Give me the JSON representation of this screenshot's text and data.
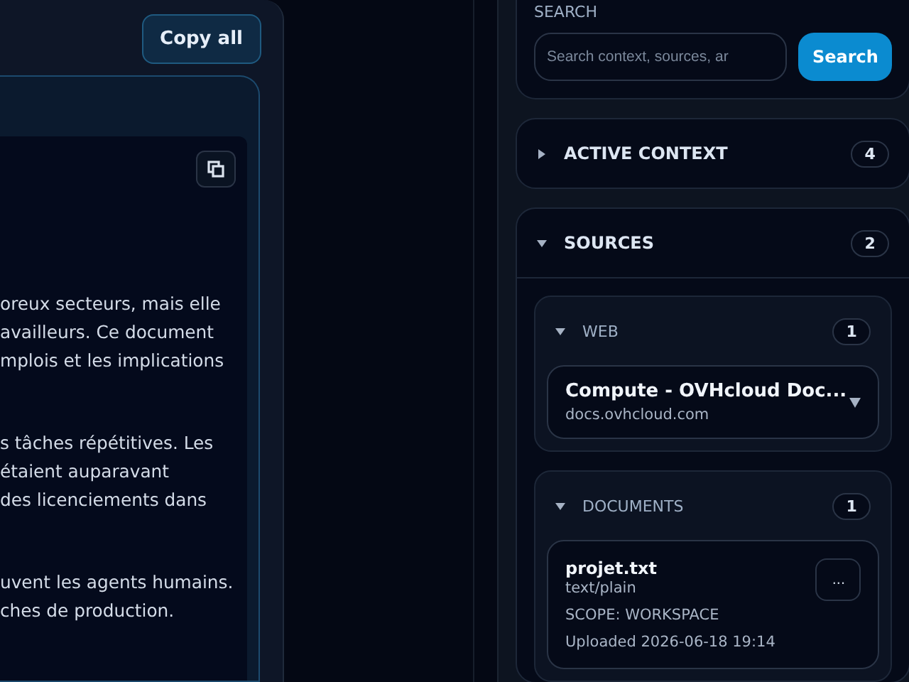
{
  "output_panel": {
    "copy_all_button": "Copy all",
    "paragraphs": [
      [
        "oreux secteurs, mais elle",
        "availleurs. Ce document",
        "mplois et les implications"
      ],
      [
        "s tâches répétitives. Les",
        "étaient auparavant",
        "des licenciements dans"
      ],
      [
        "uvent les agents humains.",
        "ches de production."
      ]
    ]
  },
  "sidebar": {
    "search": {
      "label": "SEARCH",
      "placeholder": "Search context, sources, ar",
      "button": "Search"
    },
    "sections": [
      {
        "title": "ACTIVE CONTEXT",
        "count": "4",
        "expanded": false
      },
      {
        "title": "SOURCES",
        "count": "2",
        "expanded": true,
        "groups": [
          {
            "title": "WEB",
            "count": "1",
            "expanded": true,
            "items": [
              {
                "kind": "link",
                "title": "Compute - OVHcloud Doc...",
                "subtitle": "docs.ovhcloud.com"
              }
            ]
          },
          {
            "title": "DOCUMENTS",
            "count": "1",
            "expanded": true,
            "items": [
              {
                "kind": "file",
                "name": "projet.txt",
                "type": "text/plain",
                "scope": "SCOPE: WORKSPACE",
                "uploaded": "Uploaded 2026-06-18 19:14",
                "menu": "..."
              }
            ]
          }
        ]
      }
    ]
  }
}
